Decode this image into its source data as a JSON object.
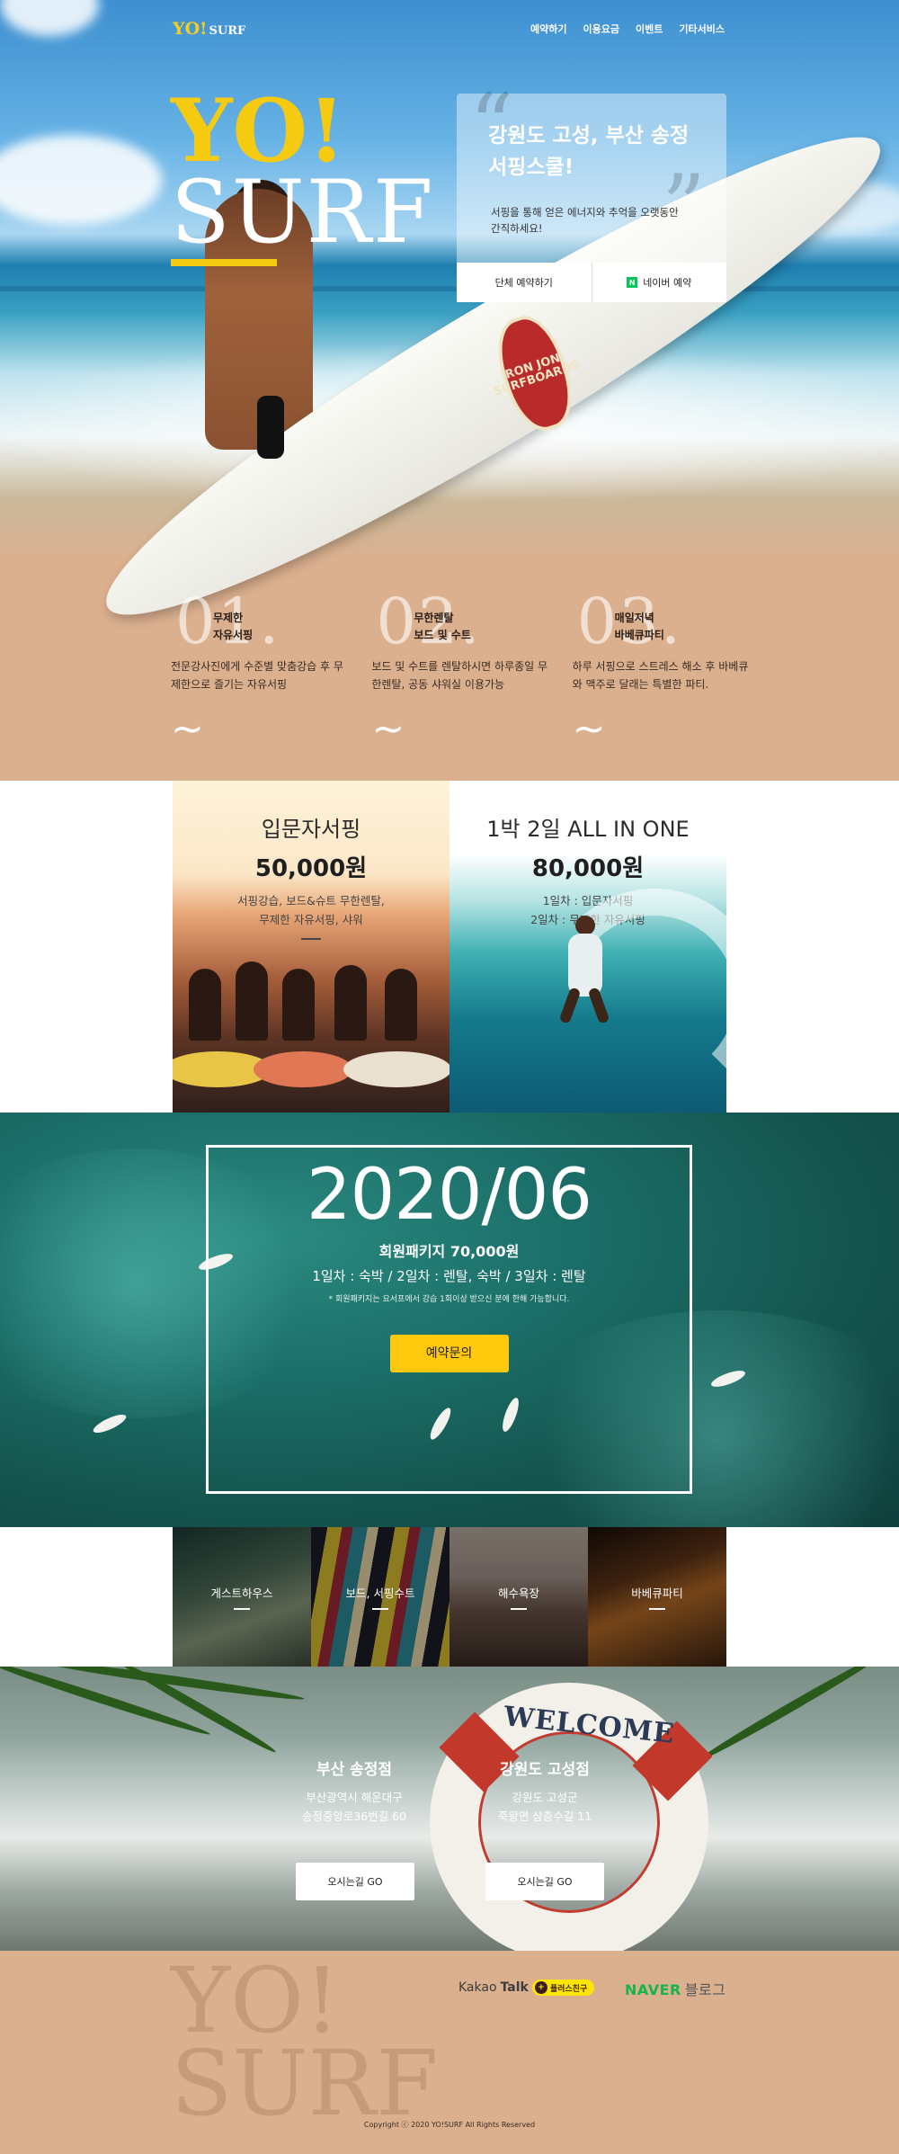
{
  "brand": {
    "logo_yo": "YO!",
    "logo_surf": "SURF"
  },
  "nav": {
    "items": [
      "예약하기",
      "이용요금",
      "이벤트",
      "기타서비스"
    ]
  },
  "hero": {
    "big_yo": "YO!",
    "big_surf": "SURF",
    "board_logo": "RON JON SURFBOARDS",
    "card": {
      "title": "강원도 고성, 부산 송정 서핑스쿨!",
      "subtitle": "서핑을 통해 얻은 에너지와 추억을 오랫동안 간직하세요!",
      "btn_group": "단체 예약하기",
      "btn_naver": "네이버 예약",
      "naver_icon_letter": "N"
    }
  },
  "features": [
    {
      "num": "01.",
      "title_1": "무제한",
      "title_2": "자유서핑",
      "desc": "전문강사진에게 수준별 맞춤강습 후 무제한으로 즐기는 자유서핑"
    },
    {
      "num": "02.",
      "title_1": "무한렌탈",
      "title_2": "보드 및 수트",
      "desc": "보드 및 수트를 렌탈하시면 하루종일 무한렌탈, 공동 샤워실 이용가능"
    },
    {
      "num": "03.",
      "title_1": "매일저녁",
      "title_2": "바베큐파티",
      "desc": "하루 서핑으로 스트레스 해소 후 바베큐와 맥주로 달래는 특별한 파티."
    }
  ],
  "wave_glyph": "~",
  "prices": [
    {
      "title": "입문자서핑",
      "amount": "50,000원",
      "desc_1": "서핑강습, 보드&슈트 무한렌탈,",
      "desc_2": "무제한 자유서핑, 샤워"
    },
    {
      "title": "1박 2일 ALL IN ONE",
      "amount": "80,000원",
      "desc_1": "1일차 : 입문자서핑",
      "desc_2": "2일차 : 무제한 자유서핑"
    }
  ],
  "event": {
    "date": "2020/06",
    "package": "회원패키지 70,000원",
    "schedule": "1일차 : 숙박 / 2일차 : 렌탈, 숙박 / 3일차 : 렌탈",
    "note": "* 회원패키지는 요서프에서 강습 1회이상 받으신 분에 한해 가능합니다.",
    "button": "예약문의"
  },
  "facilities": [
    "게스트하우스",
    "보드, 서핑수트",
    "해수욕장",
    "바베큐파티"
  ],
  "locations": {
    "ring_text": "WELCOME",
    "branches": [
      {
        "name": "부산 송정점",
        "addr_1": "부산광역시 해운대구",
        "addr_2": "송정중앙로36번길 60",
        "button": "오시는길 GO"
      },
      {
        "name": "강원도 고성점",
        "addr_1": "강원도 고성군",
        "addr_2": "죽왕면 삼층수길 11",
        "button": "오시는길 GO"
      }
    ]
  },
  "footer": {
    "ghost_yo": "YO!",
    "ghost_surf": "SURF",
    "kakao_prefix": "Kakao",
    "kakao_bold": "Talk",
    "kakao_badge": "플러스친구",
    "kakao_badge_icon": "+",
    "naver_brand": "NAVER",
    "naver_blog": "블로그",
    "copyright": "Copyright ⓒ 2020 YO!SURF All Rights Reserved"
  },
  "colors": {
    "accent_yellow": "#f5cb12",
    "sand": "#dbb08f",
    "event_button": "#ffc90e",
    "naver_green": "#16b54b"
  }
}
